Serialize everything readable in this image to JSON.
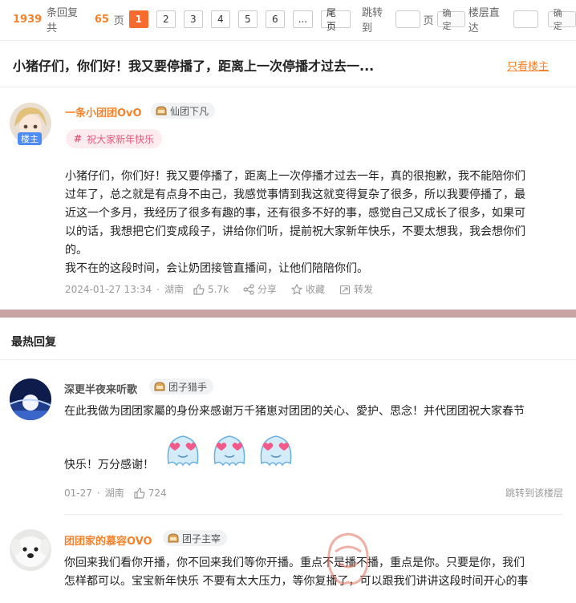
{
  "pager": {
    "total_count": "1939",
    "count_suffix": "条回复 共",
    "total_pages": "65",
    "pages_suffix": "页",
    "pages": [
      "1",
      "2",
      "3",
      "4",
      "5",
      "6",
      "..."
    ],
    "last_label": "尾页",
    "jump_label": "跳转到",
    "page_unit": "页",
    "confirm_label": "确定",
    "floor_label": "楼层直达",
    "floor_confirm_label": "确定"
  },
  "thread": {
    "title": "小猪仔们，你们好！我又要停播了，距离上一次停播才过去一...",
    "only_host_label": "只看楼主"
  },
  "main_post": {
    "username": "一条小团团OvO",
    "level": "仙团下凡",
    "host_tag": "楼主",
    "topic": "祝大家新年快乐",
    "lines": [
      "小猪仔们，你们好！我又要停播了，距离上一次停播才过去一年，真的很抱歉，我不能陪你们",
      "过年了，总之就是有点身不由己，我感觉事情到我这就变得复杂了很多，所以我要停播了，最",
      "近这一个多月，我经历了很多有趣的事，还有很多不好的事，感觉自己又成长了很多，如果可",
      "以的话，我想把它们变成段子，讲给你们听，提前祝大家新年快乐，不要太想我，我会想你们",
      "的。",
      "我不在的这段时间，会让奶团接管直播间，让他们陪陪你们。"
    ],
    "time": "2024-01-27 13:34",
    "location": "湖南",
    "likes": "5.7k",
    "share_label": "分享",
    "fav_label": "收藏",
    "forward_label": "转发"
  },
  "hot": {
    "section_title": "最热回复",
    "replies": [
      {
        "username": "深更半夜来听歌",
        "level": "团子猎手",
        "lines": [
          "在此我做为团团家屬的身份来感谢万千猪崽对团团的关心、愛护、思念！并代团团祝大家春节",
          "快乐！万分感谢！"
        ],
        "date": "01-27",
        "location": "湖南",
        "likes": "724",
        "jump_label": "跳转到该楼层"
      },
      {
        "username": "团团家的慕容OVO",
        "level": "团子主宰",
        "lines": [
          "你回来我们看你开播，你不回来我们等你开播。重点不是播不播，重点是你。只要是你，我们",
          "怎样都可以。宝宝新年快乐 不要有太大压力，等你复播了，可以跟我们讲讲这段时间开心的事"
        ]
      }
    ]
  },
  "colors": {
    "accent": "#f5822b",
    "active_page": "#f86b2f",
    "host_tag": "#4e8cf5",
    "topic_text": "#e85778",
    "topic_bg": "#fdecef",
    "divider_band": "#c9a4a4"
  }
}
